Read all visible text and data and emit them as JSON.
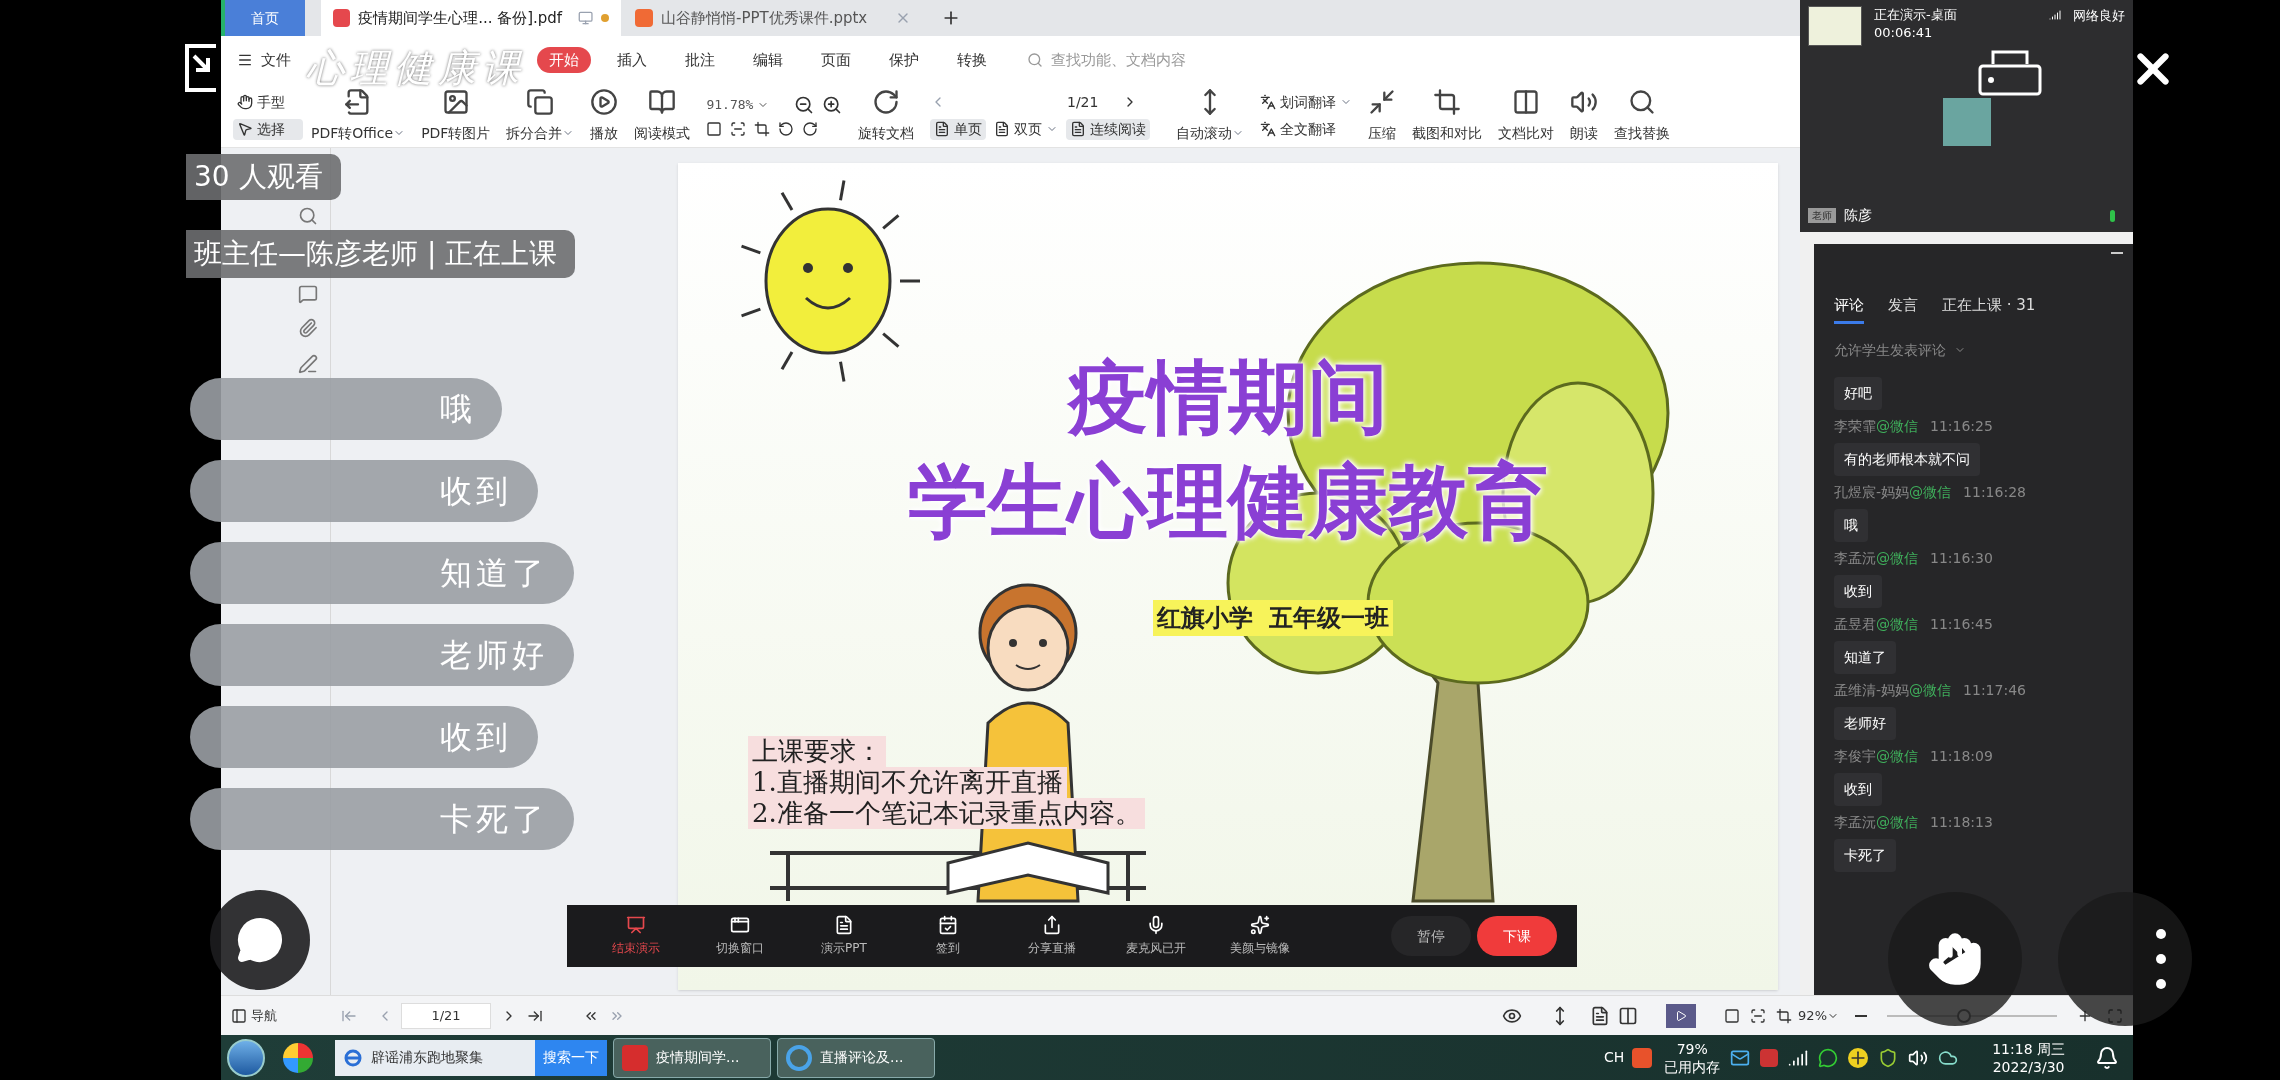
{
  "overlay": {
    "stream_title": "心理健康课",
    "viewer_count": "30 人观看",
    "host_status": "班主任—陈彦老师 | 正在上课",
    "danmaku": [
      {
        "text": "哦"
      },
      {
        "text": "收到"
      },
      {
        "text": "知道了"
      },
      {
        "text": "老师好"
      },
      {
        "text": "收到"
      },
      {
        "text": "卡死了"
      }
    ]
  },
  "tabs": [
    {
      "label": "首页",
      "kind": "home",
      "selected": false
    },
    {
      "label": "疫情期间学生心理... 备份].pdf",
      "kind": "pdf",
      "selected": true
    },
    {
      "label": "山谷静悄悄-PPT优秀课件.pptx",
      "kind": "ppt",
      "selected": false
    }
  ],
  "menu": {
    "file": "文件",
    "items": [
      {
        "label": "开始",
        "selected": true
      },
      {
        "label": "插入",
        "selected": false
      },
      {
        "label": "批注",
        "selected": false
      },
      {
        "label": "编辑",
        "selected": false
      },
      {
        "label": "页面",
        "selected": false
      },
      {
        "label": "保护",
        "selected": false
      },
      {
        "label": "转换",
        "selected": false
      }
    ],
    "search": {
      "placeholder": "查找功能、文档内容"
    }
  },
  "toolbar": {
    "pointer_modes": [
      {
        "label": "手型",
        "selected": false
      },
      {
        "label": "选择",
        "selected": true
      }
    ],
    "tools": [
      {
        "label": "PDF转Office",
        "dropdown": true
      },
      {
        "label": "PDF转图片",
        "dropdown": false
      },
      {
        "label": "拆分合并",
        "dropdown": true
      },
      {
        "label": "播放",
        "dropdown": false
      },
      {
        "label": "阅读模式",
        "dropdown": false
      }
    ],
    "zoom": "91.78%",
    "rotate": "旋转文档",
    "page": "1/21",
    "view_modes": [
      {
        "label": "单页",
        "selected": true,
        "dropdown": false
      },
      {
        "label": "双页",
        "selected": false,
        "dropdown": true
      },
      {
        "label": "连续阅读",
        "selected": true,
        "dropdown": false
      }
    ],
    "auto_scroll": "自动滚动",
    "translate": [
      "划词翻译",
      "全文翻译"
    ],
    "tools_right": [
      "压缩",
      "截图和对比",
      "文档比对",
      "朗读",
      "查找替换"
    ]
  },
  "slide": {
    "title_1": "疫情期间",
    "title_2": "学生心理健康教育",
    "subtitle": "红旗小学  五年级一班",
    "requirements_title": "上课要求：",
    "requirements": [
      "1.直播期间不允许离开直播",
      "2.准备一个笔记本记录重点内容。"
    ]
  },
  "live_toolbar": {
    "tools": [
      {
        "label": "结束演示",
        "kind": "stop"
      },
      {
        "label": "切换窗口",
        "kind": "tool"
      },
      {
        "label": "演示PPT",
        "kind": "tool"
      },
      {
        "label": "签到",
        "kind": "tool"
      },
      {
        "label": "分享直播",
        "kind": "tool"
      },
      {
        "label": "麦克风已开",
        "kind": "tool"
      },
      {
        "label": "美颜与镜像",
        "kind": "tool"
      }
    ],
    "buttons": [
      {
        "label": "暂停",
        "kind": "secondary"
      },
      {
        "label": "下课",
        "kind": "primary"
      }
    ]
  },
  "camera": {
    "status": "正在演示-桌面",
    "duration": "00:06:41",
    "network": "网络良好",
    "role": "老师",
    "name": "陈彦"
  },
  "chat": {
    "tabs": [
      {
        "label": "评论",
        "selected": true
      },
      {
        "label": "发言",
        "selected": false
      },
      {
        "label": "正在上课 · 31",
        "selected": false
      }
    ],
    "filter": "允许学生发表评论",
    "messages": [
      {
        "text": "好吧"
      },
      {
        "name": "李荣霏",
        "source": "@微信",
        "time": "11:16:25",
        "text": "有的老师根本就不问"
      },
      {
        "name": "孔煜宸-妈妈",
        "source": "@微信",
        "time": "11:16:28",
        "text": "哦"
      },
      {
        "name": "李孟沅",
        "source": "@微信",
        "time": "11:16:30",
        "text": "收到"
      },
      {
        "name": "孟昱君",
        "source": "@微信",
        "time": "11:16:45",
        "text": "知道了"
      },
      {
        "name": "孟维清-妈妈",
        "source": "@微信",
        "time": "11:17:46",
        "text": "老师好"
      },
      {
        "name": "李俊宇",
        "source": "@微信",
        "time": "11:18:09",
        "text": "收到"
      },
      {
        "name": "李孟沅",
        "source": "@微信",
        "time": "11:18:13",
        "text": "卡死了"
      }
    ]
  },
  "status_bar": {
    "nav": "导航",
    "page": "1/21",
    "zoom": "92%",
    "zoom_slider": {
      "level": 0.45
    }
  },
  "taskbar": {
    "browser_field": "辟谣浦东跑地聚集",
    "search_button": "搜索一下",
    "windows": [
      "疫情期间学...",
      "直播评论及..."
    ],
    "ime": "CH",
    "memory_percent": "79%",
    "memory_label": "已用内存",
    "time": "11:18 周三",
    "date": "2022/3/30"
  }
}
